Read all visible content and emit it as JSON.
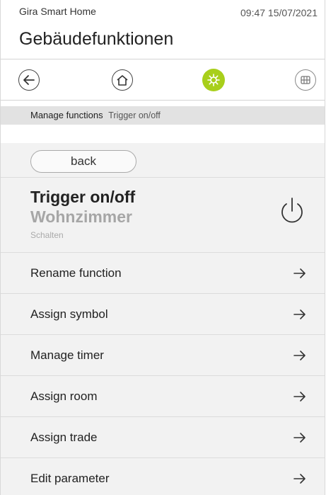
{
  "status_bar": {
    "app_name": "Gira Smart Home",
    "datetime": "09:47 15/07/2021"
  },
  "page": {
    "title": "Gebäudefunktionen"
  },
  "nav": {
    "icons": [
      "arrow-left-icon",
      "home-icon",
      "gear-icon",
      "grid-icon"
    ],
    "active": "gear-icon",
    "active_color": "#a8cf1b"
  },
  "breadcrumb": {
    "main": "Manage functions",
    "sub": "Trigger on/off"
  },
  "back": {
    "label": "back"
  },
  "function": {
    "title": "Trigger on/off",
    "room": "Wohnzimmer",
    "type": "Schalten",
    "icon": "power-icon"
  },
  "menu": {
    "items": [
      {
        "label": "Rename function"
      },
      {
        "label": "Assign symbol"
      },
      {
        "label": "Manage timer"
      },
      {
        "label": "Assign room"
      },
      {
        "label": "Assign trade"
      },
      {
        "label": "Edit parameter"
      }
    ]
  }
}
